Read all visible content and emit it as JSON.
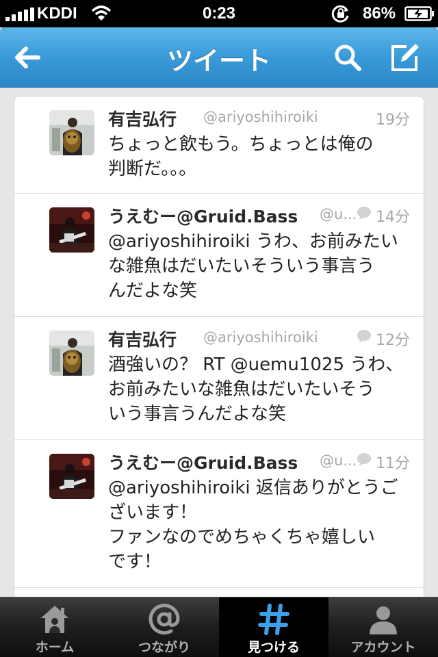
{
  "status_bar": {
    "carrier": "KDDI",
    "time": "0:23",
    "battery": "86%"
  },
  "nav": {
    "title": "ツイート",
    "icons": [
      "back-arrow-icon",
      "search-icon",
      "compose-icon"
    ]
  },
  "tweets": [
    {
      "name": "有吉弘行",
      "handle": "@ariyoshihiroiki",
      "time": "19分",
      "has_reply": false,
      "text": "ちょっと飲もう。ちょっとは俺の\n判断だ。。。"
    },
    {
      "name": "うえむー@Gruid.Bass",
      "handle": "@u...",
      "time": "14分",
      "has_reply": true,
      "text": "@ariyoshihiroiki うわ、お前みたい\nな雑魚はだいたいそういう事言う\nんだよな笑"
    },
    {
      "name": "有吉弘行",
      "handle": "@ariyoshihiroiki",
      "time": "12分",
      "has_reply": true,
      "text": "酒強いの？ RT @uemu1025 うわ、\nお前みたいな雑魚はだいたいそう\nいう事言うんだよな笑"
    },
    {
      "name": "うえむー@Gruid.Bass",
      "handle": "@u...",
      "time": "11分",
      "has_reply": true,
      "text": "@ariyoshihiroiki 返信ありがとうご\nざいます！\nファンなのでめちゃくちゃ嬉しい\nです！"
    }
  ],
  "tabs": [
    {
      "label": "ホーム",
      "icon": "home-icon",
      "active": false
    },
    {
      "label": "つながり",
      "icon": "at-sign-icon",
      "active": false
    },
    {
      "label": "見つける",
      "icon": "hashtag-icon",
      "active": true
    },
    {
      "label": "アカウント",
      "icon": "person-icon",
      "active": false
    }
  ],
  "colors": {
    "nav_blue": "#3a9ad9",
    "active_tab_icon": "#3aa0ea",
    "handle_gray": "#a6a6a6"
  }
}
